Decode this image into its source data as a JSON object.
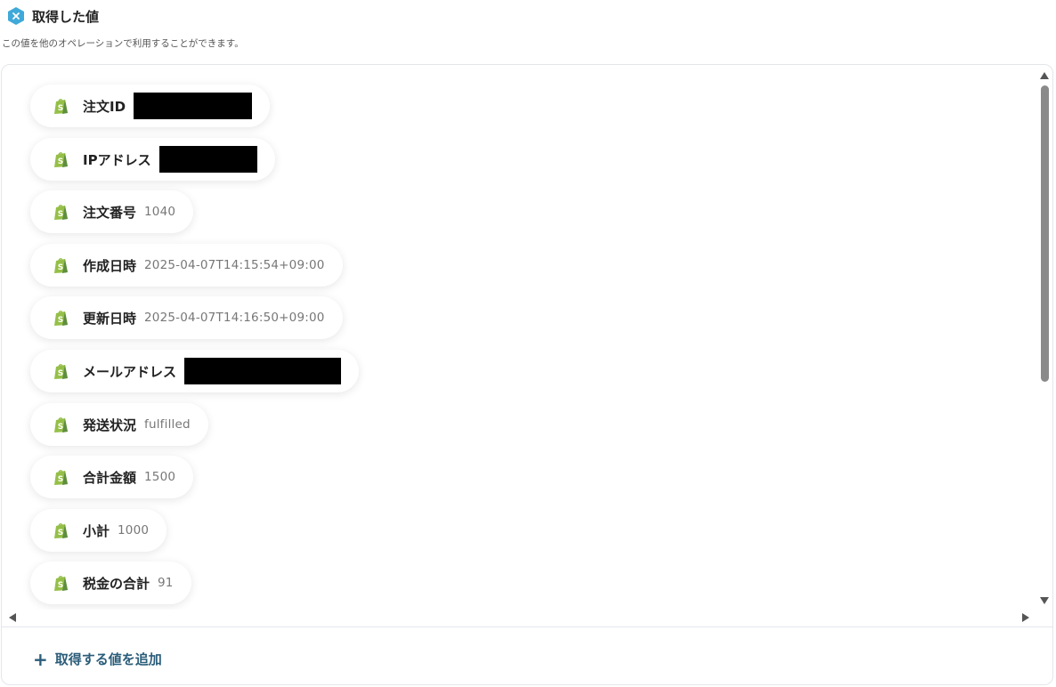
{
  "header": {
    "title": "取得した値",
    "icon": "close-badge-icon",
    "icon_color": "#3fa9d9"
  },
  "subtitle": "この値を他のオペレーションで利用することができます。",
  "items": [
    {
      "label": "注文ID",
      "value": "",
      "redacted": true
    },
    {
      "label": "IPアドレス",
      "value": "",
      "redacted": true
    },
    {
      "label": "注文番号",
      "value": "1040",
      "redacted": false
    },
    {
      "label": "作成日時",
      "value": "2025-04-07T14:15:54+09:00",
      "redacted": false
    },
    {
      "label": "更新日時",
      "value": "2025-04-07T14:16:50+09:00",
      "redacted": false
    },
    {
      "label": "メールアドレス",
      "value": "",
      "redacted": true
    },
    {
      "label": "発送状況",
      "value": "fulfilled",
      "redacted": false
    },
    {
      "label": "合計金額",
      "value": "1500",
      "redacted": false
    },
    {
      "label": "小計",
      "value": "1000",
      "redacted": false
    },
    {
      "label": "税金の合計",
      "value": "91",
      "redacted": false
    }
  ],
  "item_icon": "shopify-icon",
  "shopify_color": "#95bf47",
  "add_button": {
    "label": "取得する値を追加",
    "icon": "plus-icon",
    "color": "#2b5d7a"
  }
}
